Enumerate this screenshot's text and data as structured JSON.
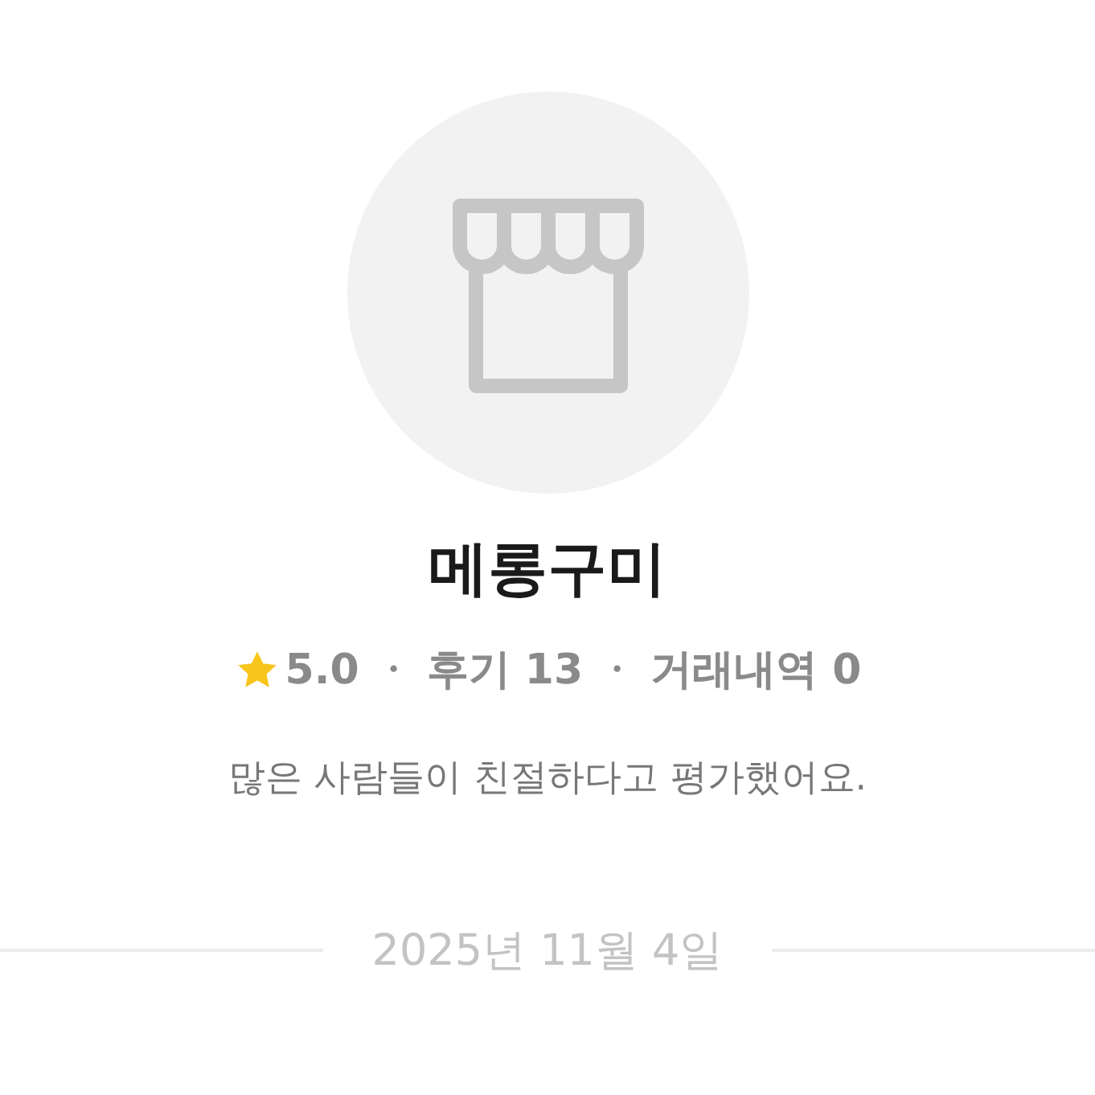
{
  "profile": {
    "name": "메롱구미",
    "stats": [
      {
        "kind": "rating",
        "text": "5.0"
      },
      {
        "kind": "separator",
        "text": "・"
      },
      {
        "kind": "stat",
        "text": "후기 13"
      },
      {
        "kind": "separator",
        "text": "・"
      },
      {
        "kind": "stat",
        "text": "거래내역 0"
      }
    ],
    "description": "많은 사람들이 친절하다고 평가했어요."
  },
  "date_divider": {
    "text": "2025년 11월 4일"
  }
}
